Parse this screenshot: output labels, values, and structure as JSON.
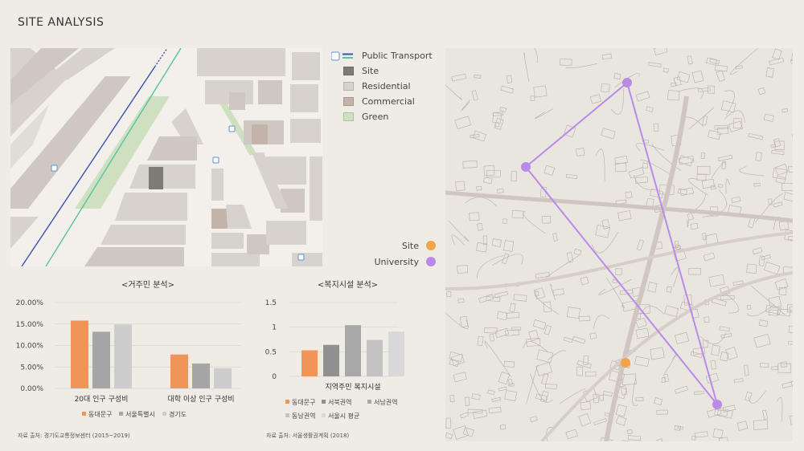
{
  "title": "SITE ANALYSIS",
  "legend_top": {
    "public_transport": "Public Transport",
    "site": "Site",
    "residential": "Residential",
    "commercial": "Commercial",
    "green": "Green",
    "colors": {
      "site": "#7e7a76",
      "residential": "#d7d2cd",
      "commercial": "#c4b3a8",
      "green": "#cfe0c0",
      "transport_blue": "#3c4fb0",
      "transport_teal": "#56c2a6"
    }
  },
  "legend_map": {
    "site": "Site",
    "university": "University",
    "colors": {
      "site": "#f2a44a",
      "university": "#b98ae8"
    }
  },
  "chart_data": [
    {
      "type": "bar",
      "title": "<거주민 분석>",
      "categories": [
        "20대 인구 구성비",
        "대학 이상 인구 구성비"
      ],
      "yticks": [
        "20.00%",
        "15.00%",
        "10.00%",
        "5.00%",
        "0.00%"
      ],
      "ylim": [
        0,
        20
      ],
      "series": [
        {
          "name": "동대문구",
          "values": [
            15.8,
            7.9
          ],
          "color": "#f0955a"
        },
        {
          "name": "서울특별시",
          "values": [
            13.2,
            5.8
          ],
          "color": "#a6a6a6"
        },
        {
          "name": "경기도",
          "values": [
            14.9,
            4.7
          ],
          "color": "#cdcdcd"
        }
      ],
      "source": "자료 출처: 경기도교통정보센터 (2015~2019)"
    },
    {
      "type": "bar",
      "title": "<복지시설 분석>",
      "categories": [
        "지역주민 복지시설"
      ],
      "yticks": [
        "1.5",
        "1",
        "0.5",
        "0"
      ],
      "ylim": [
        0,
        1.5
      ],
      "series": [
        {
          "name": "동대문구",
          "values": [
            0.53
          ],
          "color": "#f0955a"
        },
        {
          "name": "서북권역",
          "values": [
            0.64
          ],
          "color": "#909090"
        },
        {
          "name": "서남권역",
          "values": [
            1.04
          ],
          "color": "#a8a8a8"
        },
        {
          "name": "동남권역",
          "values": [
            0.74
          ],
          "color": "#c2c2c2"
        },
        {
          "name": "서울시 평균",
          "values": [
            0.91
          ],
          "color": "#d8d8d8"
        }
      ],
      "source": "자료 출처: 서울생활권계획 (2018)"
    }
  ],
  "icons": {
    "bus": "bus-stop-icon"
  }
}
